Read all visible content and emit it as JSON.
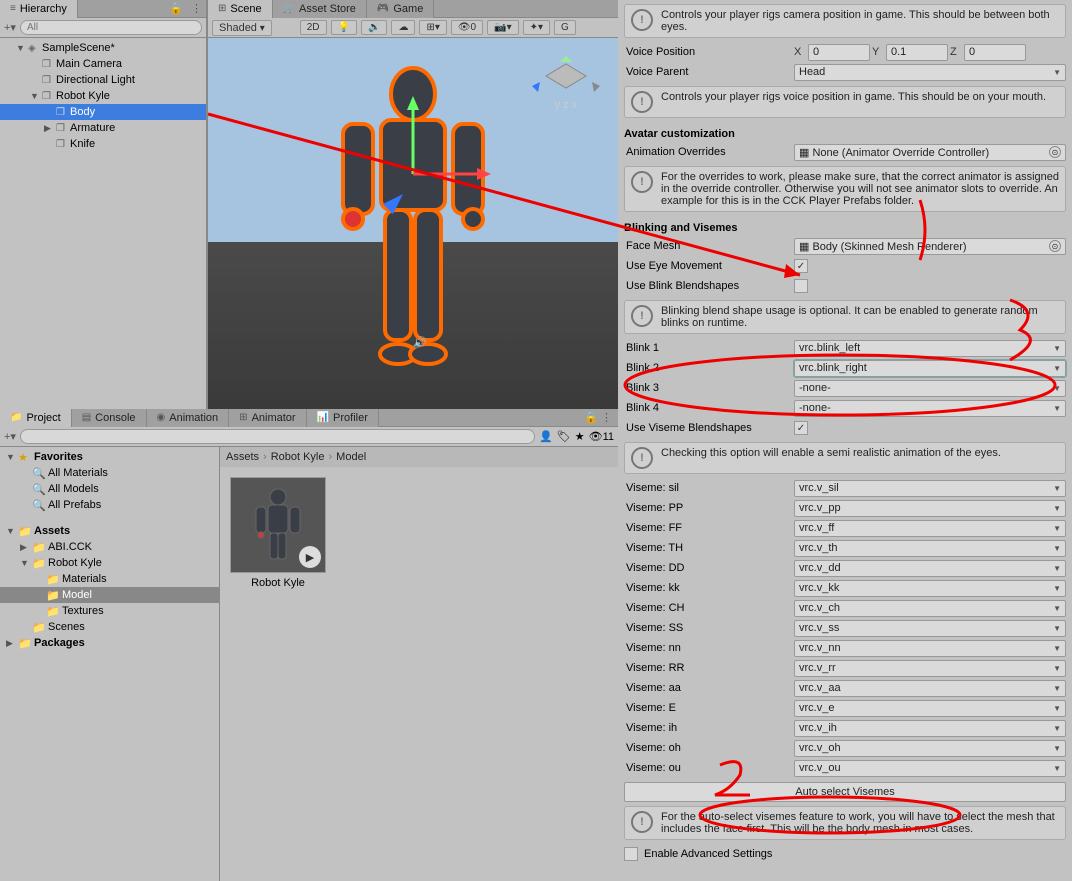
{
  "hierarchy": {
    "tab": "Hierarchy",
    "search_placeholder": "All",
    "items": [
      {
        "label": "SampleScene*",
        "icon": "unity",
        "depth": 1,
        "arrow": "▼"
      },
      {
        "label": "Main Camera",
        "icon": "cube",
        "depth": 2,
        "arrow": ""
      },
      {
        "label": "Directional Light",
        "icon": "cube",
        "depth": 2,
        "arrow": ""
      },
      {
        "label": "Robot Kyle",
        "icon": "cube",
        "depth": 2,
        "arrow": "▼"
      },
      {
        "label": "Body",
        "icon": "cube",
        "depth": 3,
        "arrow": "",
        "selected": true
      },
      {
        "label": "Armature",
        "icon": "cube",
        "depth": 3,
        "arrow": "▶"
      },
      {
        "label": "Knife",
        "icon": "cube",
        "depth": 3,
        "arrow": ""
      }
    ]
  },
  "scene": {
    "tabs": [
      "Scene",
      "Asset Store",
      "Game"
    ],
    "active_tab": 0,
    "shading": "Shaded",
    "btn_2d": "2D",
    "btn_g": "G"
  },
  "project": {
    "tabs": [
      "Project",
      "Console",
      "Animation",
      "Animator",
      "Profiler"
    ],
    "active_tab": 0,
    "breadcrumb": [
      "Assets",
      "Robot Kyle",
      "Model"
    ],
    "item_name": "Robot Kyle",
    "visible_count": "11",
    "tree": [
      {
        "label": "Favorites",
        "depth": 0,
        "arrow": "▼",
        "icon": "★",
        "fav": true
      },
      {
        "label": "All Materials",
        "depth": 1,
        "arrow": "",
        "icon": "🔍"
      },
      {
        "label": "All Models",
        "depth": 1,
        "arrow": "",
        "icon": "🔍"
      },
      {
        "label": "All Prefabs",
        "depth": 1,
        "arrow": "",
        "icon": "🔍"
      },
      {
        "label": "",
        "depth": 0,
        "arrow": "",
        "icon": "",
        "spacer": true
      },
      {
        "label": "Assets",
        "depth": 0,
        "arrow": "▼",
        "icon": "📁"
      },
      {
        "label": "ABI.CCK",
        "depth": 1,
        "arrow": "▶",
        "icon": "📁"
      },
      {
        "label": "Robot Kyle",
        "depth": 1,
        "arrow": "▼",
        "icon": "📁"
      },
      {
        "label": "Materials",
        "depth": 2,
        "arrow": "",
        "icon": "📁"
      },
      {
        "label": "Model",
        "depth": 2,
        "arrow": "",
        "icon": "📁",
        "selected": true
      },
      {
        "label": "Textures",
        "depth": 2,
        "arrow": "",
        "icon": "📁"
      },
      {
        "label": "Scenes",
        "depth": 1,
        "arrow": "",
        "icon": "📁"
      },
      {
        "label": "Packages",
        "depth": 0,
        "arrow": "▶",
        "icon": "📁"
      }
    ]
  },
  "inspector": {
    "info_camera": "Controls your player rigs camera position in game. This should be between both eyes.",
    "voice_position_label": "Voice Position",
    "voice_position": {
      "x": "0",
      "y": "0.1",
      "z": "0"
    },
    "voice_parent_label": "Voice Parent",
    "voice_parent_value": "Head",
    "info_voice": "Controls your player rigs voice position in game. This should be on your mouth.",
    "section_avatar": "Avatar customization",
    "anim_overrides_label": "Animation Overrides",
    "anim_overrides_value": "None (Animator Override Controller)",
    "info_overrides": "For the overrides to work, please make sure, that the correct animator is assigned in the override controller. Otherwise you will not see animator slots to override. An example for this is in the CCK Player Prefabs folder.",
    "section_blink": "Blinking and Visemes",
    "face_mesh_label": "Face Mesh",
    "face_mesh_value": "Body (Skinned Mesh Renderer)",
    "use_eye_label": "Use Eye Movement",
    "use_blink_label": "Use Blink Blendshapes",
    "info_blink": "Blinking blend shape usage is optional. It can be enabled to generate random blinks on runtime.",
    "blinks": [
      {
        "label": "Blink 1",
        "value": "vrc.blink_left"
      },
      {
        "label": "Blink 2",
        "value": "vrc.blink_right"
      },
      {
        "label": "Blink 3",
        "value": "-none-"
      },
      {
        "label": "Blink 4",
        "value": "-none-"
      }
    ],
    "use_viseme_label": "Use Viseme Blendshapes",
    "info_viseme": "Checking this option will enable a semi realistic animation of the eyes.",
    "visemes": [
      {
        "label": "Viseme: sil",
        "value": "vrc.v_sil"
      },
      {
        "label": "Viseme: PP",
        "value": "vrc.v_pp"
      },
      {
        "label": "Viseme: FF",
        "value": "vrc.v_ff"
      },
      {
        "label": "Viseme: TH",
        "value": "vrc.v_th"
      },
      {
        "label": "Viseme: DD",
        "value": "vrc.v_dd"
      },
      {
        "label": "Viseme: kk",
        "value": "vrc.v_kk"
      },
      {
        "label": "Viseme: CH",
        "value": "vrc.v_ch"
      },
      {
        "label": "Viseme: SS",
        "value": "vrc.v_ss"
      },
      {
        "label": "Viseme: nn",
        "value": "vrc.v_nn"
      },
      {
        "label": "Viseme: RR",
        "value": "vrc.v_rr"
      },
      {
        "label": "Viseme: aa",
        "value": "vrc.v_aa"
      },
      {
        "label": "Viseme: E",
        "value": "vrc.v_e"
      },
      {
        "label": "Viseme: ih",
        "value": "vrc.v_ih"
      },
      {
        "label": "Viseme: oh",
        "value": "vrc.v_oh"
      },
      {
        "label": "Viseme: ou",
        "value": "vrc.v_ou"
      }
    ],
    "auto_select_btn": "Auto select Visemes",
    "info_auto": "For the auto-select visemes feature to work, you will have to select the mesh that includes the face first. This will be the body mesh in most cases.",
    "enable_advanced": "Enable Advanced Settings"
  }
}
